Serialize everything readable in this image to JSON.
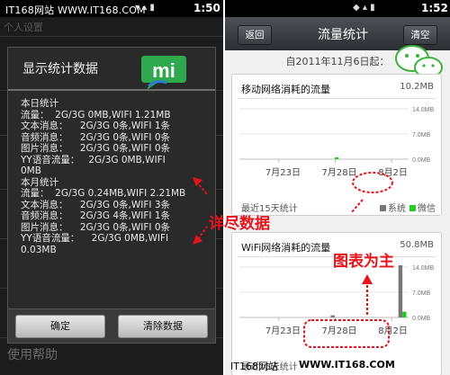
{
  "watermark_top": "IT168网站 WWW.IT168.COM",
  "watermark_bottom_left": "IT168网站",
  "watermark_bottom_right": "WWW.IT168.COM",
  "left_phone": {
    "status_time": "1:50",
    "status_icons": "▾ ▴ ▮",
    "background_title": "个人设置",
    "background_bottom_item": "使用帮助",
    "dialog": {
      "title": "显示统计数据",
      "logo_text": "mi",
      "lines": [
        "本日统计",
        "流量：  2G/3G 0MB,WIFI 1.21MB",
        "文本消息：    2G/3G 0条,WIFI 1条",
        "音频消息：    2G/3G 0条,WIFI 0条",
        "图片消息：    2G/3G 0条,WIFI 0条",
        "YY语音流量：   2G/3G 0MB,WIFI",
        "0MB",
        "本月统计",
        "流量：  2G/3G 0.24MB,WIFI 2.21MB",
        "文本消息：    2G/3G 0条,WIFI 3条",
        "音频消息：    2G/3G 4条,WIFI 1条",
        "图片消息：    2G/3G 0条,WIFI 0条",
        "YY语音流量：    2G/3G 0MB,WIFI",
        "0.03MB"
      ],
      "ok_button": "确定",
      "clear_button": "清除数据"
    }
  },
  "right_phone": {
    "status_time": "1:52",
    "status_icons": "◆ ▴ ▮",
    "back_button": "返回",
    "title": "流量统计",
    "clear_button": "清空",
    "since_text": "自2011年11月6日起：",
    "footer_text": "最近15天统计",
    "legend": {
      "system": "系统",
      "wechat": "微信"
    },
    "colors": {
      "system": "#777777",
      "wechat": "#22cc22",
      "grid": "#e4e4e4"
    }
  },
  "chart_data": [
    {
      "type": "bar",
      "title": "移动网络消耗的流量",
      "total": "10.2MB",
      "y_tick_labels": [
        "14.0MB",
        "7.0MB",
        "0.0MB"
      ],
      "ylim": [
        0,
        14
      ],
      "x_tick_labels": [
        "7月23日",
        "7月28日",
        "8月2日"
      ],
      "days": 15,
      "series": [
        {
          "name": "系统",
          "values": [
            0,
            0,
            0,
            0,
            0,
            0,
            0,
            0,
            0,
            0,
            0,
            0,
            0,
            0,
            0
          ]
        },
        {
          "name": "微信",
          "values": [
            0,
            0,
            0,
            0,
            0,
            0,
            0,
            0,
            0.1,
            0,
            0,
            0,
            0,
            0,
            0
          ]
        }
      ]
    },
    {
      "type": "bar",
      "title": "WiFi网络消耗的流量",
      "total": "50.8MB",
      "y_tick_labels": [
        "14.0MB",
        "7.0MB",
        "0.0MB"
      ],
      "ylim": [
        0,
        14
      ],
      "x_tick_labels": [
        "7月23日",
        "7月28日",
        "8月2日"
      ],
      "days": 15,
      "series": [
        {
          "name": "系统",
          "values": [
            0,
            0,
            0,
            0,
            0,
            0,
            0,
            0,
            0.6,
            0,
            0,
            0,
            0,
            0,
            14.5
          ]
        },
        {
          "name": "微信",
          "values": [
            0,
            0,
            0,
            0,
            0,
            0,
            0,
            0,
            0,
            0,
            0,
            0,
            0,
            0,
            1.6
          ]
        }
      ]
    }
  ],
  "annotations": {
    "detail": "详尽数据",
    "chart_main": "图表为主"
  }
}
